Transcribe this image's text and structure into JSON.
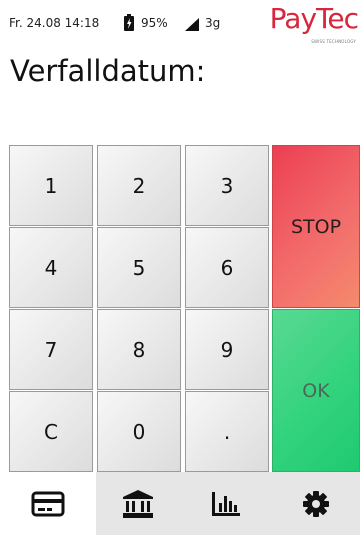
{
  "status_bar": {
    "datetime": "Fr. 24.08 14:18",
    "battery": "95%",
    "network": "3g",
    "icons": [
      "battery-charging-icon",
      "signal-icon"
    ]
  },
  "logo": {
    "word": "PayTec",
    "tagline": "SWISS TECHNOLOGY"
  },
  "title": "Verfalldatum:",
  "keypad": {
    "keys": [
      "1",
      "2",
      "3",
      "4",
      "5",
      "6",
      "7",
      "8",
      "9",
      "C",
      "0",
      "."
    ],
    "stop_label": "STOP",
    "ok_label": "OK"
  },
  "tabs": [
    {
      "icon": "card-icon",
      "active": true
    },
    {
      "icon": "bank-icon",
      "active": false
    },
    {
      "icon": "bar-chart-icon",
      "active": false
    },
    {
      "icon": "gear-icon",
      "active": false
    }
  ],
  "colors": {
    "stop": "#ee4b58",
    "ok": "#33d37e",
    "logo": "#d7263d"
  }
}
